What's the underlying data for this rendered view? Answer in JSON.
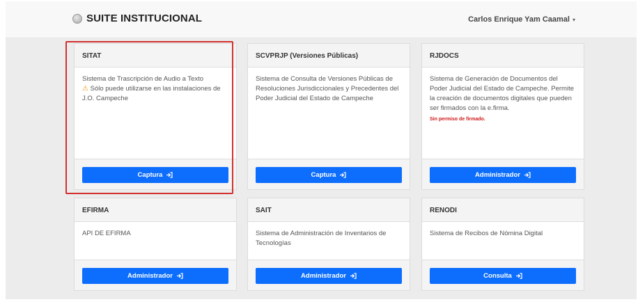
{
  "navbar": {
    "brand": "SUITE INSTITUCIONAL",
    "brand_icon": "seal-icon",
    "user_name": "Carlos Enrique Yam Caamal",
    "user_caret": "▾"
  },
  "colors": {
    "button": "#0d6efd",
    "highlight": "#d32f2f",
    "note": "#d01818",
    "warning": "#e0a000"
  },
  "cards": [
    {
      "title": "SITAT",
      "description": "Sistema de Trascripción de Audio a Texto",
      "warning_icon": "⚠",
      "warning_text": "Sólo puede utilizarse en las instalaciones de J.O. Campeche",
      "button": "Captura"
    },
    {
      "title": "SCVPRJP (Versiones Públicas)",
      "description": "Sistema de Consulta de Versiones Públicas de Resoluciones Jurisdiccionales y Precedentes del Poder Judicial del Estado de Campeche",
      "button": "Captura"
    },
    {
      "title": "RJDOCS",
      "description": "Sistema de Generación de Documentos del Poder Judicial del Estado de Campeche. Permite la creación de documentos digitales que pueden ser firmados con la e.firma.",
      "note": "Sin permiso de firmado.",
      "button": "Administrador"
    },
    {
      "title": "EFIRMA",
      "description": "API DE EFIRMA",
      "button": "Administrador"
    },
    {
      "title": "SAIT",
      "description": "Sistema de Administración de Inventarios de Tecnologías",
      "button": "Administrador"
    },
    {
      "title": "RENODI",
      "description": "Sistema de Recibos de Nómina Digital",
      "button": "Consulta"
    }
  ]
}
